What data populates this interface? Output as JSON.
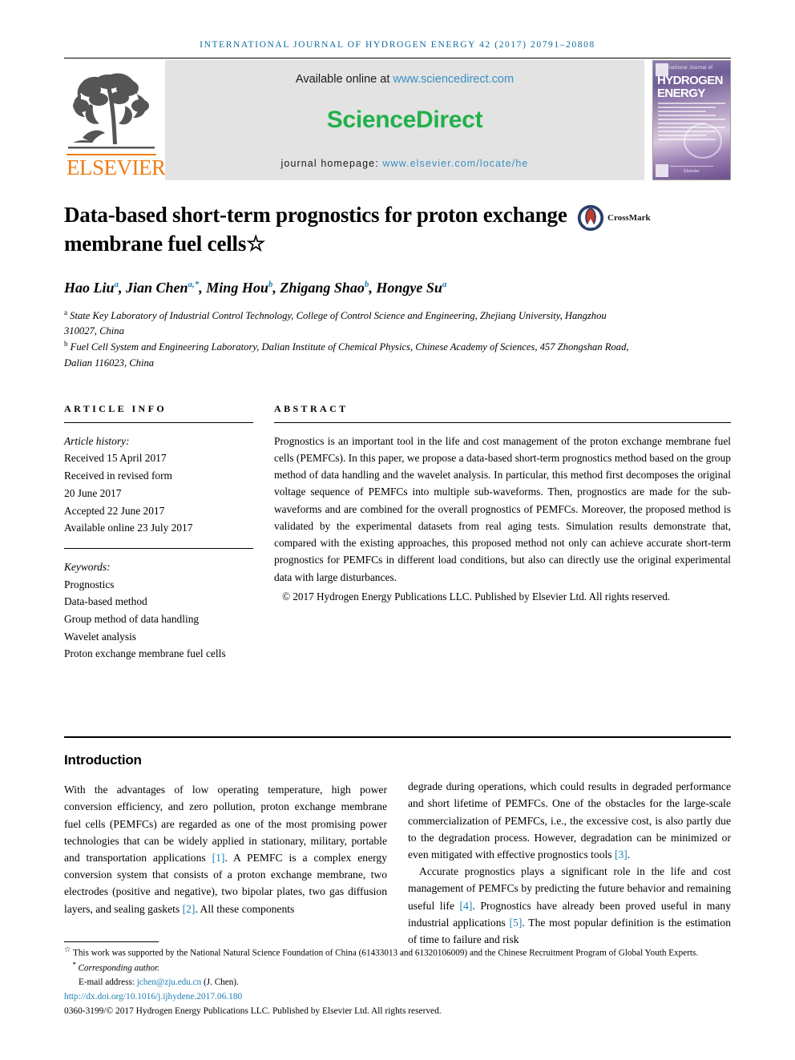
{
  "running_head": "International Journal of Hydrogen Energy 42 (2017) 20791–20808",
  "masthead": {
    "publisher_name": "ELSEVIER",
    "available_prefix": "Available online at ",
    "available_link": "www.sciencedirect.com",
    "sciencedirect_title": "ScienceDirect",
    "homepage_prefix": "journal homepage: ",
    "homepage_link": "www.elsevier.com/locate/he",
    "cover": {
      "superline": "International Journal of",
      "line1": "HYDROGEN",
      "line2": "ENERGY",
      "footer": "Elsevier"
    },
    "colors": {
      "elsevier_orange": "#f07c17",
      "sciencedirect_green": "#21b14b",
      "link_blue": "#3a8fc4",
      "band_grey": "#e3e3e3"
    }
  },
  "title": "Data-based short-term prognostics for proton exchange membrane fuel cells",
  "title_footnote_mark": "☆",
  "crossmark_label": "CrossMark",
  "authors": [
    {
      "name": "Hao Liu",
      "sup": "a"
    },
    {
      "name": "Jian Chen",
      "sup": "a,*"
    },
    {
      "name": "Ming Hou",
      "sup": "b"
    },
    {
      "name": "Zhigang Shao",
      "sup": "b"
    },
    {
      "name": "Hongye Su",
      "sup": "a"
    }
  ],
  "affiliations": [
    {
      "mark": "a",
      "text": "State Key Laboratory of Industrial Control Technology, College of Control Science and Engineering, Zhejiang University, Hangzhou 310027, China"
    },
    {
      "mark": "b",
      "text": "Fuel Cell System and Engineering Laboratory, Dalian Institute of Chemical Physics, Chinese Academy of Sciences, 457 Zhongshan Road, Dalian 116023, China"
    }
  ],
  "article_info": {
    "heading": "Article info",
    "history_label": "Article history:",
    "history": [
      "Received 15 April 2017",
      "Received in revised form",
      "20 June 2017",
      "Accepted 22 June 2017",
      "Available online 23 July 2017"
    ],
    "keywords_label": "Keywords:",
    "keywords": [
      "Prognostics",
      "Data-based method",
      "Group method of data handling",
      "Wavelet analysis",
      "Proton exchange membrane fuel cells"
    ]
  },
  "abstract": {
    "heading": "Abstract",
    "text": "Prognostics is an important tool in the life and cost management of the proton exchange membrane fuel cells (PEMFCs). In this paper, we propose a data-based short-term prognostics method based on the group method of data handling and the wavelet analysis. In particular, this method first decomposes the original voltage sequence of PEMFCs into multiple sub-waveforms. Then, prognostics are made for the sub-waveforms and are combined for the overall prognostics of PEMFCs. Moreover, the proposed method is validated by the experimental datasets from real aging tests. Simulation results demonstrate that, compared with the existing approaches, this proposed method not only can achieve accurate short-term prognostics for PEMFCs in different load conditions, but also can directly use the original experimental data with large disturbances.",
    "copyright": "© 2017 Hydrogen Energy Publications LLC. Published by Elsevier Ltd. All rights reserved."
  },
  "introduction": {
    "heading": "Introduction",
    "left_paragraph_1_a": "With the advantages of low operating temperature, high power conversion efficiency, and zero pollution, proton exchange membrane fuel cells (PEMFCs) are regarded as one of the most promising power technologies that can be widely applied in stationary, military, portable and transportation applications ",
    "ref1": "[1]",
    "left_paragraph_1_b": ". A PEMFC is a complex energy conversion system that consists of a proton exchange membrane, two electrodes (positive and negative), two bipolar plates, two gas diffusion layers, and sealing gaskets ",
    "ref2": "[2]",
    "left_paragraph_1_c": ". All these components",
    "right_paragraph_1_a": "degrade during operations, which could results in degraded performance and short lifetime of PEMFCs. One of the obstacles for the large-scale commercialization of PEMFCs, i.e., the excessive cost, is also partly due to the degradation process. However, degradation can be minimized or even mitigated with effective prognostics tools ",
    "ref3": "[3]",
    "right_paragraph_1_b": ".",
    "right_paragraph_2_a": "Accurate prognostics plays a significant role in the life and cost management of PEMFCs by predicting the future behavior and remaining useful life ",
    "ref4": "[4]",
    "right_paragraph_2_b": ". Prognostics have already been proved useful in many industrial applications ",
    "ref5": "[5]",
    "right_paragraph_2_c": ". The most popular definition is the estimation of time to failure and risk"
  },
  "footnotes": {
    "funding": "This work was supported by the National Natural Science Foundation of China (61433013 and 61320106009) and the Chinese Recruitment Program of Global Youth Experts.",
    "funding_mark": "☆",
    "corresponding": "Corresponding author.",
    "corresponding_mark": "*",
    "email_label": "E-mail address: ",
    "email": "jchen@zju.edu.cn",
    "email_suffix": " (J. Chen).",
    "doi": "http://dx.doi.org/10.1016/j.ijhydene.2017.06.180",
    "issn_line": "0360-3199/© 2017 Hydrogen Energy Publications LLC. Published by Elsevier Ltd. All rights reserved."
  }
}
